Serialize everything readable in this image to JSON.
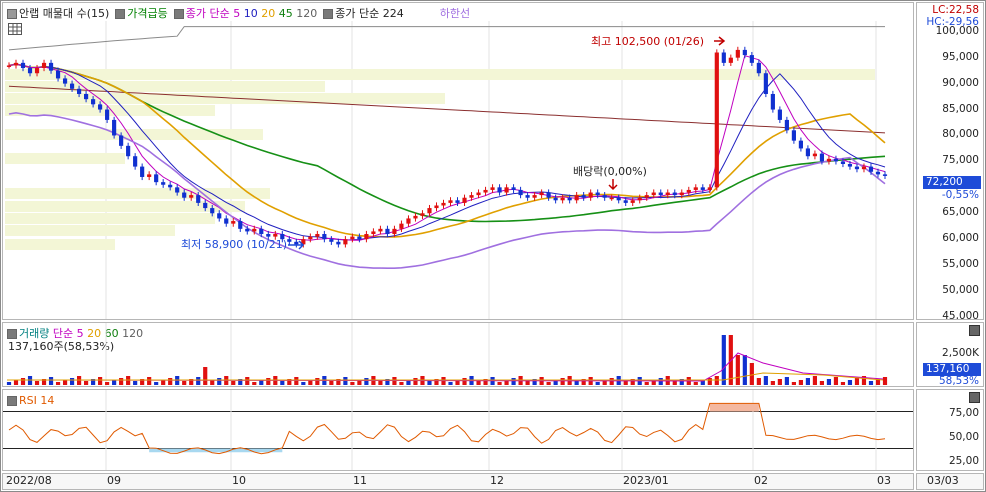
{
  "price_panel": {
    "legend": [
      {
        "label": "안랩 매물대 수(15)",
        "color": "#000000",
        "box": "#9a9a9a"
      },
      {
        "label": "가격급등",
        "color": "#008000",
        "box": "#7a7a7a"
      },
      {
        "label": "종가 단순",
        "color": "#c000c0",
        "box": "#7a7a7a"
      },
      {
        "label": "5",
        "color": "#c000c0"
      },
      {
        "label": "10",
        "color": "#2020c0"
      },
      {
        "label": "20",
        "color": "#e0a000"
      },
      {
        "label": "45",
        "color": "#108010"
      },
      {
        "label": "120",
        "color": "#606060"
      },
      {
        "label": "종가 단순 224",
        "color": "#000000",
        "box": "#7a7a7a"
      },
      {
        "label": "하한선",
        "color": "#a070e0"
      }
    ],
    "lc_label": "LC:22,58",
    "hc_label": "HC:-29,56",
    "high_annotation": "최고 102,500 (01/26)",
    "low_annotation": "최저 58,900 (10/21)",
    "dividend_annotation": "배당락(0,00%)",
    "yaxis_ticks": [
      "100,000",
      "95,000",
      "90,000",
      "85,000",
      "80,000",
      "75,000",
      "70,000",
      "65,000",
      "60,000",
      "55,000",
      "50,000",
      "45,000"
    ],
    "current_price": "72,200",
    "current_change": "-0,55%"
  },
  "volume_panel": {
    "legend": [
      {
        "label": "거래량",
        "color": "#008080"
      },
      {
        "label": "단순",
        "color": "#c000c0"
      },
      {
        "label": "5",
        "color": "#c000c0"
      },
      {
        "label": "20",
        "color": "#e0a000"
      },
      {
        "label": "60",
        "color": "#108010"
      },
      {
        "label": "120",
        "color": "#606060"
      }
    ],
    "summary": "137,160주(58,53%)",
    "yaxis_tick": "2,500K",
    "current_volume": "137,160",
    "current_ratio": "58,53%"
  },
  "rsi_panel": {
    "legend": "RSI 14",
    "yaxis_ticks": [
      "75,00",
      "50,00",
      "25,00"
    ]
  },
  "xaxis": {
    "labels": [
      "2022/08",
      "09",
      "10",
      "11",
      "12",
      "2023/01",
      "02",
      "03"
    ],
    "right_label": "03/03"
  },
  "chart_data": {
    "type": "candlestick",
    "y_range": [
      45000,
      104000
    ],
    "high": 102500,
    "low": 58900,
    "last_close": 72200,
    "closes": [
      93500,
      94000,
      93000,
      92000,
      93000,
      94000,
      92500,
      91000,
      90000,
      89000,
      88000,
      87000,
      86000,
      85000,
      83000,
      80000,
      78000,
      76000,
      74000,
      72000,
      72500,
      71000,
      70500,
      70000,
      69000,
      68000,
      68500,
      67000,
      66000,
      65000,
      64000,
      63000,
      63500,
      62000,
      61500,
      62000,
      61000,
      60500,
      61000,
      60000,
      59500,
      59000,
      60000,
      60500,
      61000,
      60000,
      59500,
      59000,
      60000,
      60500,
      60000,
      61000,
      61500,
      62000,
      61000,
      62000,
      63000,
      64000,
      64500,
      65000,
      66000,
      66500,
      67000,
      67500,
      67000,
      68000,
      68500,
      69000,
      69500,
      70000,
      69000,
      70000,
      69500,
      68500,
      68000,
      68500,
      69000,
      68000,
      67500,
      68000,
      67500,
      68500,
      68000,
      69000,
      68500,
      68000,
      68000,
      67500,
      67000,
      67500,
      68000,
      68500,
      69000,
      68500,
      69000,
      68500,
      69000,
      69500,
      70000,
      69500,
      70000,
      96000,
      94000,
      95000,
      96500,
      95500,
      94000,
      92000,
      88000,
      85000,
      83000,
      81000,
      79000,
      77500,
      76000,
      76500,
      75000,
      75500,
      75000,
      74500,
      74000,
      73500,
      74000,
      73000,
      72500,
      72200
    ]
  }
}
